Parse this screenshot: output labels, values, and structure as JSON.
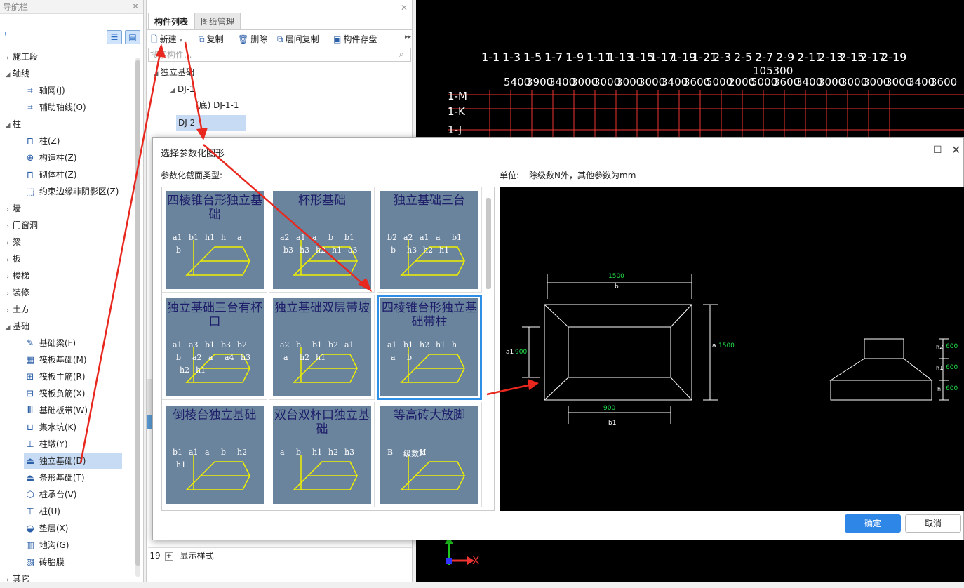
{
  "nav": {
    "title": "导航栏",
    "items": [
      {
        "label": "施工段",
        "type": "group",
        "expanded": false
      },
      {
        "label": "轴线",
        "type": "group",
        "expanded": true
      },
      {
        "label": "轴网(J)",
        "type": "child"
      },
      {
        "label": "辅助轴线(O)",
        "type": "child"
      },
      {
        "label": "柱",
        "type": "group",
        "expanded": true
      },
      {
        "label": "柱(Z)",
        "type": "child"
      },
      {
        "label": "构造柱(Z)",
        "type": "child"
      },
      {
        "label": "砌体柱(Z)",
        "type": "child"
      },
      {
        "label": "约束边缘非阴影区(Z)",
        "type": "child"
      },
      {
        "label": "墙",
        "type": "group",
        "expanded": false
      },
      {
        "label": "门窗洞",
        "type": "group",
        "expanded": false
      },
      {
        "label": "梁",
        "type": "group",
        "expanded": false
      },
      {
        "label": "板",
        "type": "group",
        "expanded": false
      },
      {
        "label": "楼梯",
        "type": "group",
        "expanded": false
      },
      {
        "label": "装修",
        "type": "group",
        "expanded": false
      },
      {
        "label": "土方",
        "type": "group",
        "expanded": false
      },
      {
        "label": "基础",
        "type": "group",
        "expanded": true
      },
      {
        "label": "基础梁(F)",
        "type": "child"
      },
      {
        "label": "筏板基础(M)",
        "type": "child"
      },
      {
        "label": "筏板主筋(R)",
        "type": "child"
      },
      {
        "label": "筏板负筋(X)",
        "type": "child"
      },
      {
        "label": "基础板带(W)",
        "type": "child"
      },
      {
        "label": "集水坑(K)",
        "type": "child"
      },
      {
        "label": "柱墩(Y)",
        "type": "child"
      },
      {
        "label": "独立基础(D)",
        "type": "child",
        "selected": true
      },
      {
        "label": "条形基础(T)",
        "type": "child"
      },
      {
        "label": "桩承台(V)",
        "type": "child"
      },
      {
        "label": "桩(U)",
        "type": "child"
      },
      {
        "label": "垫层(X)",
        "type": "child"
      },
      {
        "label": "地沟(G)",
        "type": "child"
      },
      {
        "label": "砖胎膜",
        "type": "child"
      },
      {
        "label": "其它",
        "type": "group",
        "expanded": false
      }
    ]
  },
  "comp": {
    "tabs": [
      "构件列表",
      "图纸管理"
    ],
    "toolbar": {
      "new": "新建",
      "copy": "复制",
      "delete": "删除",
      "floor_copy": "层间复制",
      "save": "构件存盘"
    },
    "search_placeholder": "搜索构件...",
    "tree": {
      "root": "独立基础",
      "node": "DJ-1",
      "leaf": "(底) DJ-1-1",
      "selected": "DJ-2"
    },
    "rows": [
      {
        "num": "19",
        "label": "显示样式"
      }
    ]
  },
  "cad": {
    "axis_top": [
      "1-1",
      "1-3",
      "1-5",
      "1-7",
      "1-9",
      "1-11",
      "1-13",
      "1-15",
      "1-17",
      "1-19",
      "1-21",
      "2-3",
      "2-5",
      "2-7",
      "2-9",
      "2-11",
      "2-13",
      "2-15",
      "2-17",
      "2-19"
    ],
    "dims": [
      "5400",
      "3900",
      "3400",
      "3000",
      "3000",
      "3000",
      "3000",
      "3400",
      "3600",
      "5000",
      "2000",
      "5000",
      "3600",
      "3400",
      "3000",
      "3000",
      "3000",
      "3000",
      "3400",
      "3600"
    ],
    "total": "105300",
    "axis_left": [
      "1-M",
      "1-K",
      "1-J"
    ],
    "ucs_x": "X"
  },
  "dialog": {
    "title": "选择参数化图形",
    "section_label": "参数化截面类型:",
    "unit_label": "单位:",
    "unit_text": "除级数N外，其他参数为mm",
    "shapes": [
      {
        "title": "四棱锥台形独立基础",
        "labels": [
          "a1",
          "b1",
          "h1",
          "h",
          "a",
          "b"
        ]
      },
      {
        "title": "杯形基础",
        "labels": [
          "a2",
          "a1",
          "a",
          "b",
          "b1",
          "b3",
          "h3",
          "h2",
          "h1",
          "a3"
        ]
      },
      {
        "title": "独立基础三台",
        "labels": [
          "b2",
          "a2",
          "a1",
          "a",
          "b1",
          "b",
          "h3",
          "h2",
          "h1"
        ]
      },
      {
        "title": "独立基础三台有杯口",
        "labels": [
          "a1",
          "a3",
          "b1",
          "b3",
          "b2",
          "b",
          "a2",
          "a",
          "a4",
          "h3",
          "h2",
          "h1"
        ]
      },
      {
        "title": "独立基础双层带坡",
        "labels": [
          "a2",
          "b",
          "b1",
          "b2",
          "a1",
          "a",
          "h2",
          "h1"
        ]
      },
      {
        "title": "四棱锥台形独立基础带柱",
        "labels": [
          "a1",
          "b1",
          "h2",
          "h1",
          "h",
          "a",
          "b"
        ]
      },
      {
        "title": "倒棱台独立基础",
        "labels": [
          "b1",
          "a1",
          "a",
          "b",
          "h2",
          "h1"
        ]
      },
      {
        "title": "双台双杯口独立基础",
        "labels": [
          "a",
          "b",
          "h1",
          "h2",
          "h3"
        ]
      },
      {
        "title": "等高砖大放脚",
        "labels": [
          "B",
          "级数N",
          "H"
        ]
      }
    ],
    "selected_shape": 5,
    "preview": {
      "b_value": "1500",
      "b_label": "b",
      "a_value": "1500",
      "a_label": "a",
      "a1_value": "900",
      "a1_label": "a1",
      "b1_value": "900",
      "b1_label": "b1",
      "h2_value": "600",
      "h2_label": "h2",
      "h1_value": "600",
      "h1_label": "h1",
      "h_value": "600",
      "h_label": "h"
    },
    "ok": "确定",
    "cancel": "取消"
  },
  "colors": {
    "accent": "#2e86e6",
    "thumb_bg": "#6a849d",
    "annotation": "#e8281f",
    "cad_green": "#22e04a"
  }
}
